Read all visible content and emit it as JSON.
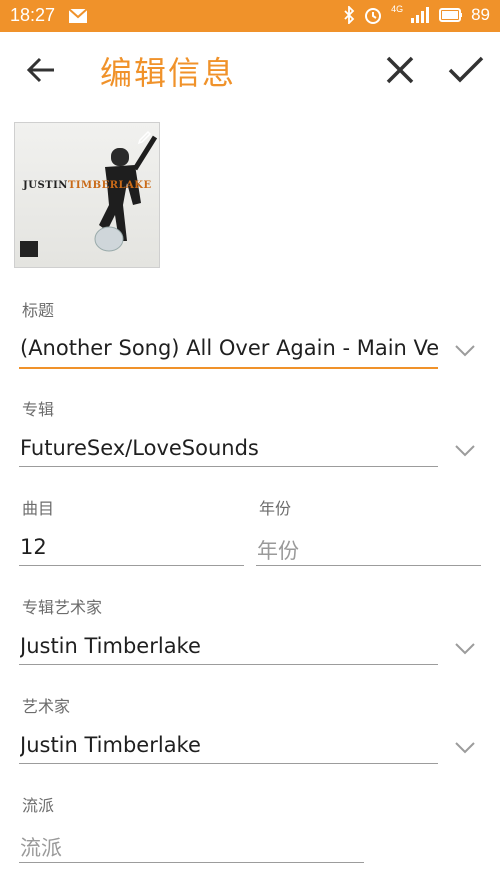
{
  "status_bar": {
    "time": "18:27",
    "battery": "89",
    "network": "4G"
  },
  "app_bar": {
    "title": "编辑信息"
  },
  "cover": {
    "text_part1": "JUSTIN",
    "text_part2": "TIMBERLAKE"
  },
  "fields": {
    "title": {
      "label": "标题",
      "value": "(Another Song) All Over Again - Main Ver"
    },
    "album": {
      "label": "专辑",
      "value": "FutureSex/LoveSounds"
    },
    "track": {
      "label": "曲目",
      "value": "12"
    },
    "year": {
      "label": "年份",
      "placeholder": "年份"
    },
    "album_artist": {
      "label": "专辑艺术家",
      "value": "Justin Timberlake"
    },
    "artist": {
      "label": "艺术家",
      "value": "Justin Timberlake"
    },
    "genre": {
      "label": "流派",
      "placeholder": "流派"
    }
  },
  "colors": {
    "accent": "#f0922a",
    "status_bar": "#f0922a"
  }
}
